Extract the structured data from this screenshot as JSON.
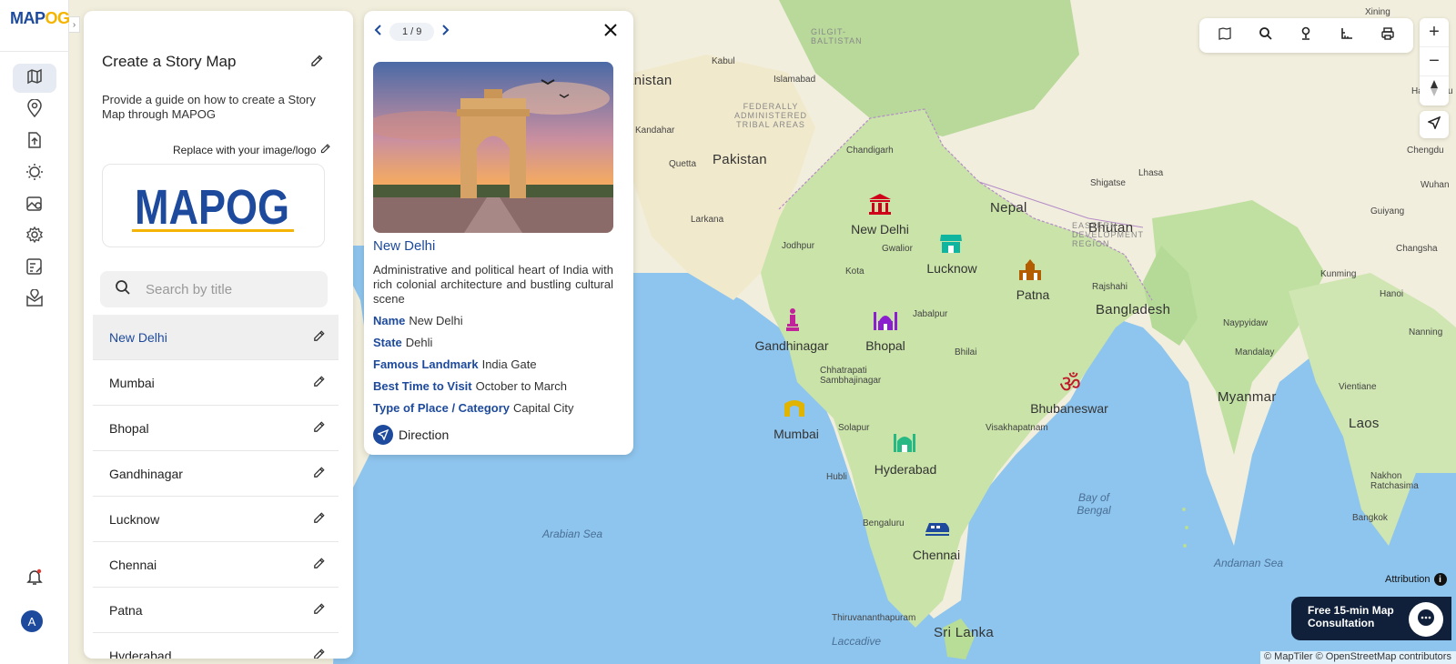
{
  "app": {
    "logo_main": "MAP",
    "logo_accent": "OG"
  },
  "rail": {
    "items": [
      {
        "icon": "map-icon"
      },
      {
        "icon": "location-pin-icon"
      },
      {
        "icon": "upload-icon"
      },
      {
        "icon": "sun-settings-icon"
      },
      {
        "icon": "gallery-pin-icon"
      },
      {
        "icon": "gear-icon"
      },
      {
        "icon": "survey-icon"
      },
      {
        "icon": "mail-pin-icon"
      }
    ],
    "avatar_letter": "A"
  },
  "story": {
    "title": "Create a Story Map",
    "description": "Provide a guide on how to create a Story Map through MAPOG",
    "replace_label": "Replace with your image/logo",
    "logo_text": "MAPOG",
    "search_placeholder": "Search by title",
    "items": [
      {
        "label": "New Delhi",
        "active": true
      },
      {
        "label": "Mumbai"
      },
      {
        "label": "Bhopal"
      },
      {
        "label": "Gandhinagar"
      },
      {
        "label": "Lucknow"
      },
      {
        "label": "Chennai"
      },
      {
        "label": "Patna"
      },
      {
        "label": "Hyderabad"
      }
    ]
  },
  "popup": {
    "pager": "1 / 9",
    "place": "New Delhi",
    "description": "Administrative and political heart of India with rich colonial architecture and bustling cultural scene",
    "attributes": [
      {
        "key": "Name",
        "value": "New Delhi"
      },
      {
        "key": "State",
        "value": "Dehli"
      },
      {
        "key": "Famous Landmark",
        "value": "India Gate"
      },
      {
        "key": "Best Time to Visit",
        "value": "October to March"
      },
      {
        "key": "Type of Place / Category",
        "value": "Capital City"
      }
    ],
    "direction_label": "Direction"
  },
  "map": {
    "countries": [
      "Afghanistan",
      "Pakistan",
      "Nepal",
      "Bhutan",
      "Bangladesh",
      "Myanmar",
      "Laos",
      "Sri Lanka"
    ],
    "seas": [
      "Arabian Sea",
      "Bay of Bengal",
      "Andaman Sea",
      "Laccadive"
    ],
    "small_labels": [
      "GILGIT-BALTISTAN",
      "FEDERALLY ADMINISTERED TRIBAL AREAS",
      "EASTERN DEVELOPMENT REGION"
    ],
    "cities": [
      "Kabul",
      "Islamabad",
      "Kandahar",
      "Quetta",
      "Chandigarh",
      "Shigatse",
      "Lhasa",
      "Larkana",
      "Jodhpur",
      "Gwalior",
      "Kota",
      "Jabalpur",
      "Rajshahi",
      "Chhatrapati Sambhajinagar",
      "Solapur",
      "Hubli",
      "Bengaluru",
      "Visakhapatnam",
      "Thiruvananthapuram",
      "Mandalay",
      "Bangkok",
      "Xining",
      "Chengdu",
      "Kunming",
      "Nanning",
      "Guiyang",
      "Changsha",
      "Wuhan",
      "Hangzhou",
      "Hanoi",
      "Vientiane",
      "Nakhon Ratchasima",
      "Naypyidaw",
      "Bhilai"
    ],
    "markers": [
      {
        "name": "New Delhi",
        "icon": "monument-icon",
        "color": "#d0021b"
      },
      {
        "name": "Lucknow",
        "icon": "shop-icon",
        "color": "#10b5a0"
      },
      {
        "name": "Patna",
        "icon": "temple-icon",
        "color": "#b35c00"
      },
      {
        "name": "Gandhinagar",
        "icon": "statue-icon",
        "color": "#c0239a"
      },
      {
        "name": "Bhopal",
        "icon": "mosque-icon",
        "color": "#8b1fcf"
      },
      {
        "name": "Bhubaneswar",
        "icon": "om-icon",
        "color": "#c0182a"
      },
      {
        "name": "Mumbai",
        "icon": "gateway-icon",
        "color": "#e0b400"
      },
      {
        "name": "Hyderabad",
        "icon": "charminar-icon",
        "color": "#27b883"
      },
      {
        "name": "Chennai",
        "icon": "train-icon",
        "color": "#1d4a9c"
      }
    ]
  },
  "controls": {
    "tools": [
      {
        "icon": "map-layers-icon"
      },
      {
        "icon": "search-icon"
      },
      {
        "icon": "pin-icon"
      },
      {
        "icon": "measure-icon"
      },
      {
        "icon": "print-icon"
      }
    ],
    "zoom_in": "+",
    "zoom_out": "−",
    "attribution": "Attribution",
    "consult_line1": "Free 15-min Map",
    "consult_line2": "Consultation",
    "credits": "© MapTiler © OpenStreetMap contributors"
  },
  "colors": {
    "brand": "#1d4a9c",
    "accent": "#f4b400",
    "sea": "#8ec5ee",
    "land": "#c9e3a8"
  }
}
